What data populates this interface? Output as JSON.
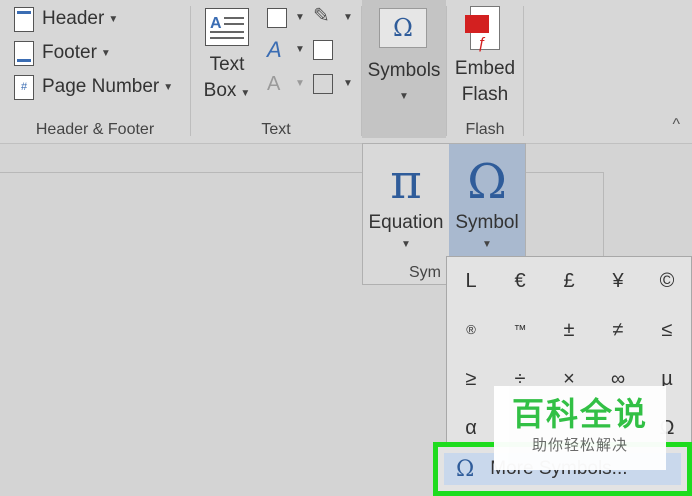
{
  "ribbon": {
    "header_footer_group": {
      "header_label": "Header",
      "footer_label": "Footer",
      "page_number_label": "Page Number",
      "group_label": "Header & Footer"
    },
    "text_group": {
      "text_box_line1": "Text",
      "text_box_line2": "Box",
      "group_label": "Text"
    },
    "symbols_button": {
      "label": "Symbols",
      "glyph": "Ω"
    },
    "flash_group": {
      "embed_label": "Embed",
      "flash_label": "Flash",
      "group_label": "Flash"
    },
    "collapse_glyph": "^"
  },
  "symbols_panel": {
    "equation_glyph": "π",
    "equation_label": "Equation",
    "symbol_glyph": "Ω",
    "symbol_label": "Symbol",
    "footer_partial": "Sym"
  },
  "gallery": {
    "rows": [
      [
        "L",
        "€",
        "£",
        "¥",
        "©"
      ],
      [
        "®",
        "™",
        "±",
        "≠",
        "≤"
      ],
      [
        "≥",
        "÷",
        "×",
        "∞",
        "µ"
      ],
      [
        "α",
        "",
        "",
        "",
        "Ω"
      ]
    ],
    "more_symbols": {
      "glyph": "Ω",
      "label": "More Symbols..."
    }
  },
  "watermark": {
    "main": "百科全说",
    "sub": "助你轻松解决"
  },
  "colors": {
    "accent": "#2f5c9a",
    "highlight_border": "#1edc1e",
    "selected_bg": "#a9b9cf"
  }
}
